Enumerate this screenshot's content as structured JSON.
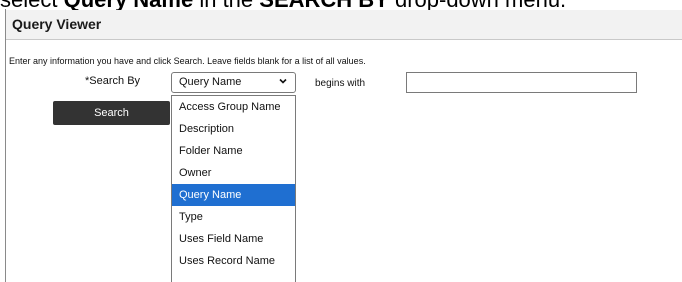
{
  "caption": {
    "prefix": "select ",
    "emphasis_1": "Query Name",
    "middle": " in the ",
    "emphasis_2": "SEARCH BY",
    "suffix": " drop-down menu."
  },
  "header": {
    "title": "Query Viewer"
  },
  "instructions": "Enter any information you have and click Search. Leave fields blank for a list of all values.",
  "search": {
    "label": "*Search By",
    "selected": "Query Name",
    "operator": "begins with",
    "value": "",
    "button_label": "Search"
  },
  "dropdown": {
    "options": [
      "Access Group Name",
      "Description",
      "Folder Name",
      "Owner",
      "Query Name",
      "Type",
      "Uses Field Name",
      "Uses Record Name"
    ],
    "highlighted_index": 4
  },
  "colors": {
    "header_bg": "#f2f2f2",
    "button_bg": "#333333",
    "highlight": "#1f6fd1"
  }
}
